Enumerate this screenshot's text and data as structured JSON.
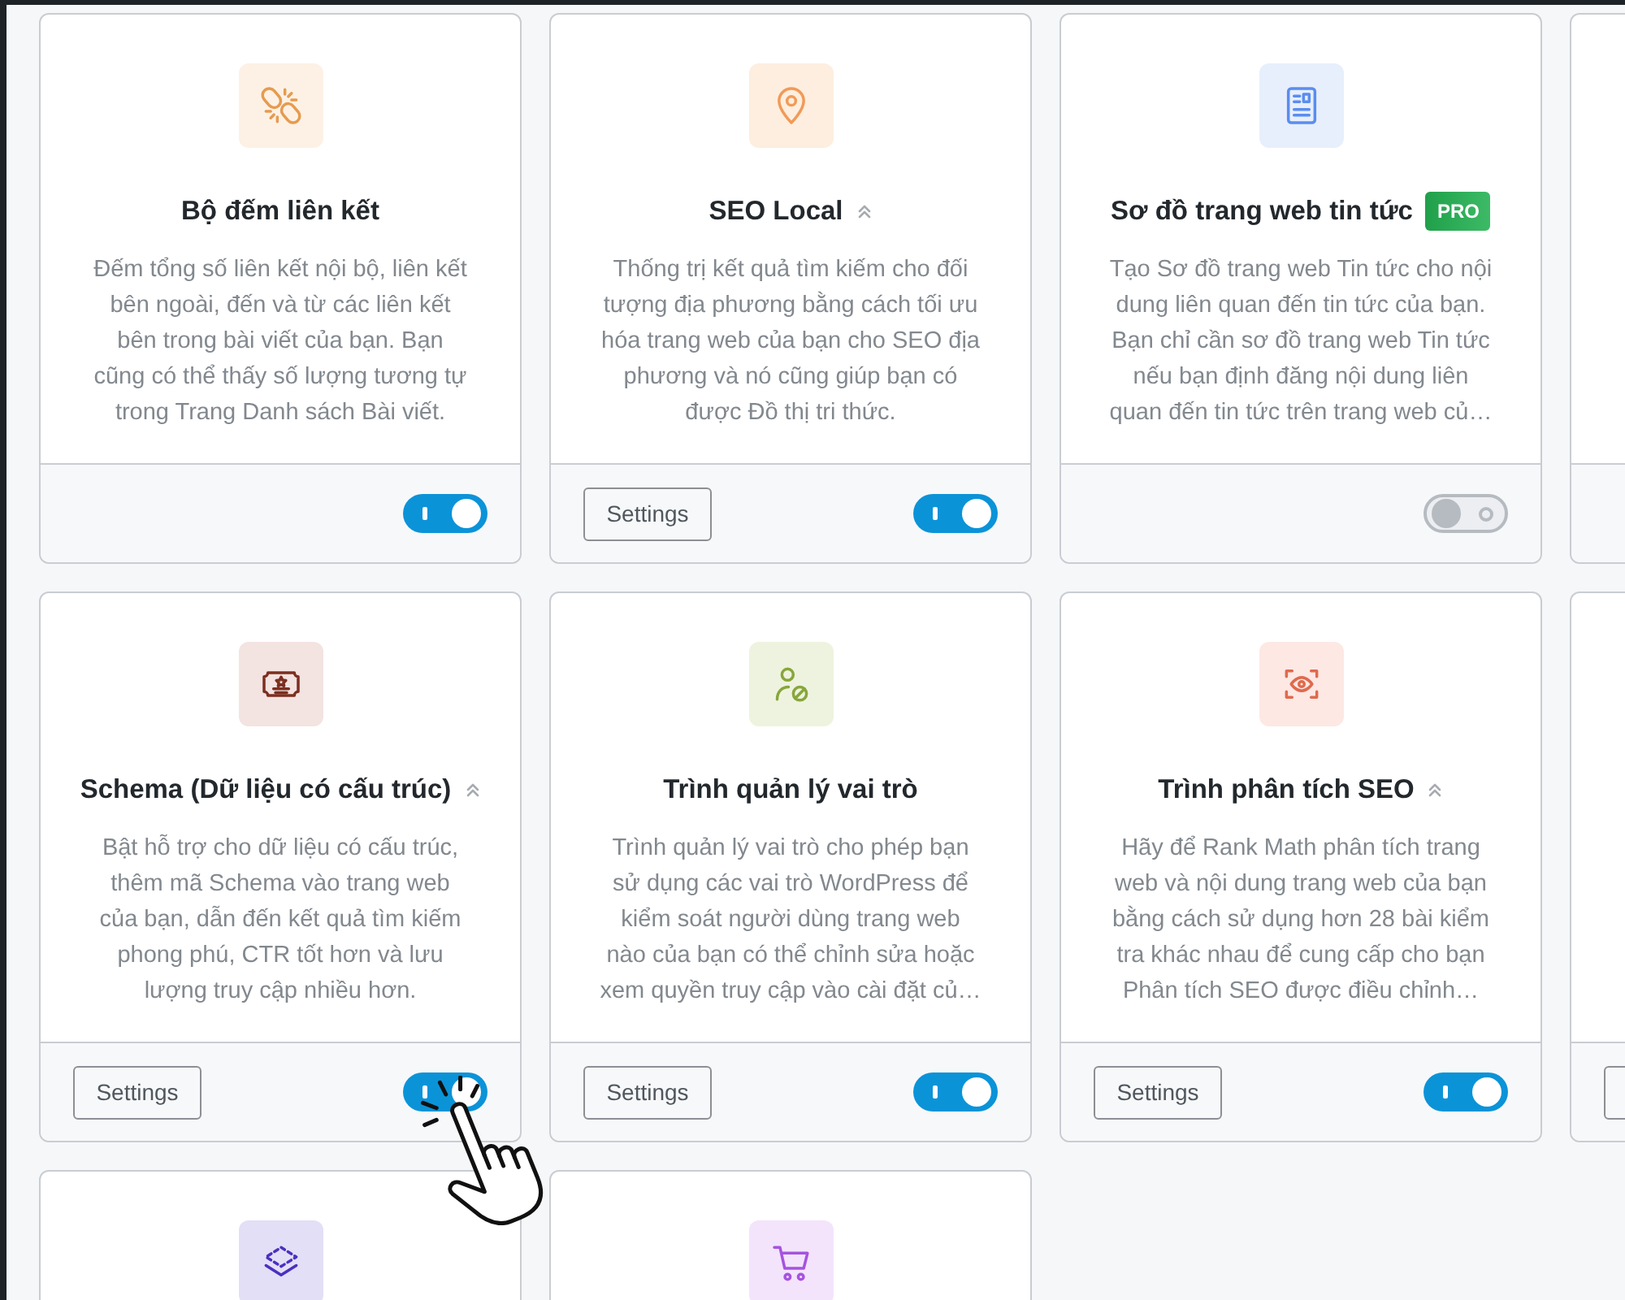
{
  "modules": [
    {
      "kind": "full",
      "title": "Bộ đếm liên kết",
      "chevrons": false,
      "description": "Đếm tổng số liên kết nội bộ, liên kết bên ngoài, đến và từ các liên kết bên trong bài viết của bạn. Bạn cũng có thể thấy số lượng tương tự trong Trang Danh sách Bài viết.",
      "on": true,
      "hand_cursor": false
    },
    {
      "kind": "full",
      "title": "SEO Local",
      "chevrons": true,
      "description": "Thống trị kết quả tìm kiếm cho đối tượng địa phương bằng cách tối ưu hóa trang web của bạn cho SEO địa phương và nó cũng giúp bạn có được Đồ thị tri thức.",
      "settings_button": "Settings",
      "on": true,
      "hand_cursor": false
    },
    {
      "kind": "full",
      "title": "Sơ đồ trang web tin tức",
      "chevrons": false,
      "badge": "PRO",
      "description": "Tạo Sơ đồ trang web Tin tức cho nội dung liên quan đến tin tức của bạn. Bạn chỉ cần sơ đồ trang web Tin tức nếu bạn định đăng nội dung liên quan đến tin tức trên trang web củ…",
      "on": false,
      "hand_cursor": false
    },
    {
      "kind": "full",
      "title": "Schema (Dữ liệu có cấu trúc)",
      "chevrons": true,
      "description": "Bật hỗ trợ cho dữ liệu có cấu trúc, thêm mã Schema vào trang web của bạn, dẫn đến kết quả tìm kiếm phong phú, CTR tốt hơn và lưu lượng truy cập nhiều hơn.",
      "settings_button": "Settings",
      "on": true,
      "hand_cursor": true
    },
    {
      "kind": "full",
      "title": "Trình quản lý vai trò",
      "chevrons": false,
      "description": "Trình quản lý vai trò cho phép bạn sử dụng các vai trò WordPress để kiểm soát người dùng trang web nào của bạn có thể chỉnh sửa hoặc xem quyền truy cập vào cài đặt củ…",
      "settings_button": "Settings",
      "on": true,
      "hand_cursor": false
    },
    {
      "kind": "full",
      "title": "Trình phân tích SEO",
      "chevrons": true,
      "description": "Hãy để Rank Math phân tích trang web và nội dung trang web của bạn bằng cách sử dụng hơn 28 bài kiểm tra khác nhau để cung cấp cho bạn Phân tích SEO được điều chỉnh…",
      "settings_button": "Settings",
      "on": true,
      "hand_cursor": false
    },
    {
      "kind": "clipped"
    },
    {
      "kind": "clipped"
    }
  ],
  "edge_cards": [
    {
      "settings_button": false
    },
    {
      "settings_button": true
    }
  ]
}
